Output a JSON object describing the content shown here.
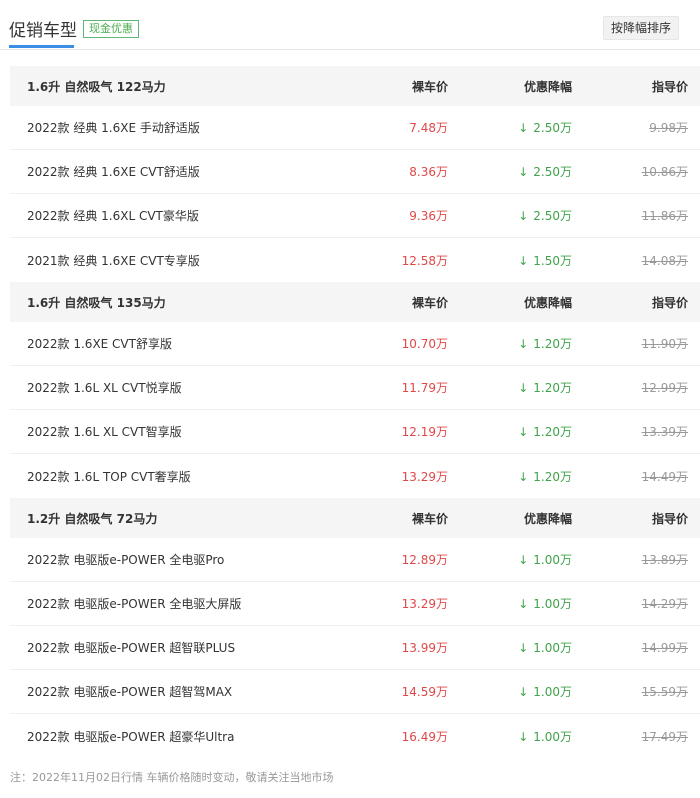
{
  "header": {
    "title": "促销车型",
    "cash_badge": "现金优惠",
    "sort_button": "按降幅排序"
  },
  "columns": {
    "price": "裸车价",
    "discount": "优惠降幅",
    "msrp": "指导价"
  },
  "arrow_icon": "↓",
  "groups": [
    {
      "title": "1.6升 自然吸气 122马力",
      "rows": [
        {
          "name": "2022款 经典 1.6XE 手动舒适版",
          "price": "7.48万",
          "discount": "2.50万",
          "msrp": "9.98万"
        },
        {
          "name": "2022款 经典 1.6XE CVT舒适版",
          "price": "8.36万",
          "discount": "2.50万",
          "msrp": "10.86万"
        },
        {
          "name": "2022款 经典 1.6XL CVT豪华版",
          "price": "9.36万",
          "discount": "2.50万",
          "msrp": "11.86万"
        },
        {
          "name": "2021款 经典 1.6XE CVT专享版",
          "price": "12.58万",
          "discount": "1.50万",
          "msrp": "14.08万"
        }
      ]
    },
    {
      "title": "1.6升 自然吸气 135马力",
      "rows": [
        {
          "name": "2022款 1.6XE CVT舒享版",
          "price": "10.70万",
          "discount": "1.20万",
          "msrp": "11.90万"
        },
        {
          "name": "2022款 1.6L XL CVT悦享版",
          "price": "11.79万",
          "discount": "1.20万",
          "msrp": "12.99万"
        },
        {
          "name": "2022款 1.6L XL CVT智享版",
          "price": "12.19万",
          "discount": "1.20万",
          "msrp": "13.39万"
        },
        {
          "name": "2022款 1.6L TOP CVT奢享版",
          "price": "13.29万",
          "discount": "1.20万",
          "msrp": "14.49万"
        }
      ]
    },
    {
      "title": "1.2升 自然吸气 72马力",
      "rows": [
        {
          "name": "2022款 电驱版e-POWER 全电驱Pro",
          "price": "12.89万",
          "discount": "1.00万",
          "msrp": "13.89万"
        },
        {
          "name": "2022款 电驱版e-POWER 全电驱大屏版",
          "price": "13.29万",
          "discount": "1.00万",
          "msrp": "14.29万"
        },
        {
          "name": "2022款 电驱版e-POWER 超智联PLUS",
          "price": "13.99万",
          "discount": "1.00万",
          "msrp": "14.99万"
        },
        {
          "name": "2022款 电驱版e-POWER 超智驾MAX",
          "price": "14.59万",
          "discount": "1.00万",
          "msrp": "15.59万"
        },
        {
          "name": "2022款 电驱版e-POWER 超豪华Ultra",
          "price": "16.49万",
          "discount": "1.00万",
          "msrp": "17.49万"
        }
      ]
    }
  ],
  "footnote": "注：2022年11月02日行情 车辆价格随时变动，敬请关注当地市场",
  "colors": {
    "price_red": "#e04848",
    "discount_green": "#3fa34a",
    "accent_blue": "#3a8ee6",
    "badge_green": "#4caf50"
  }
}
